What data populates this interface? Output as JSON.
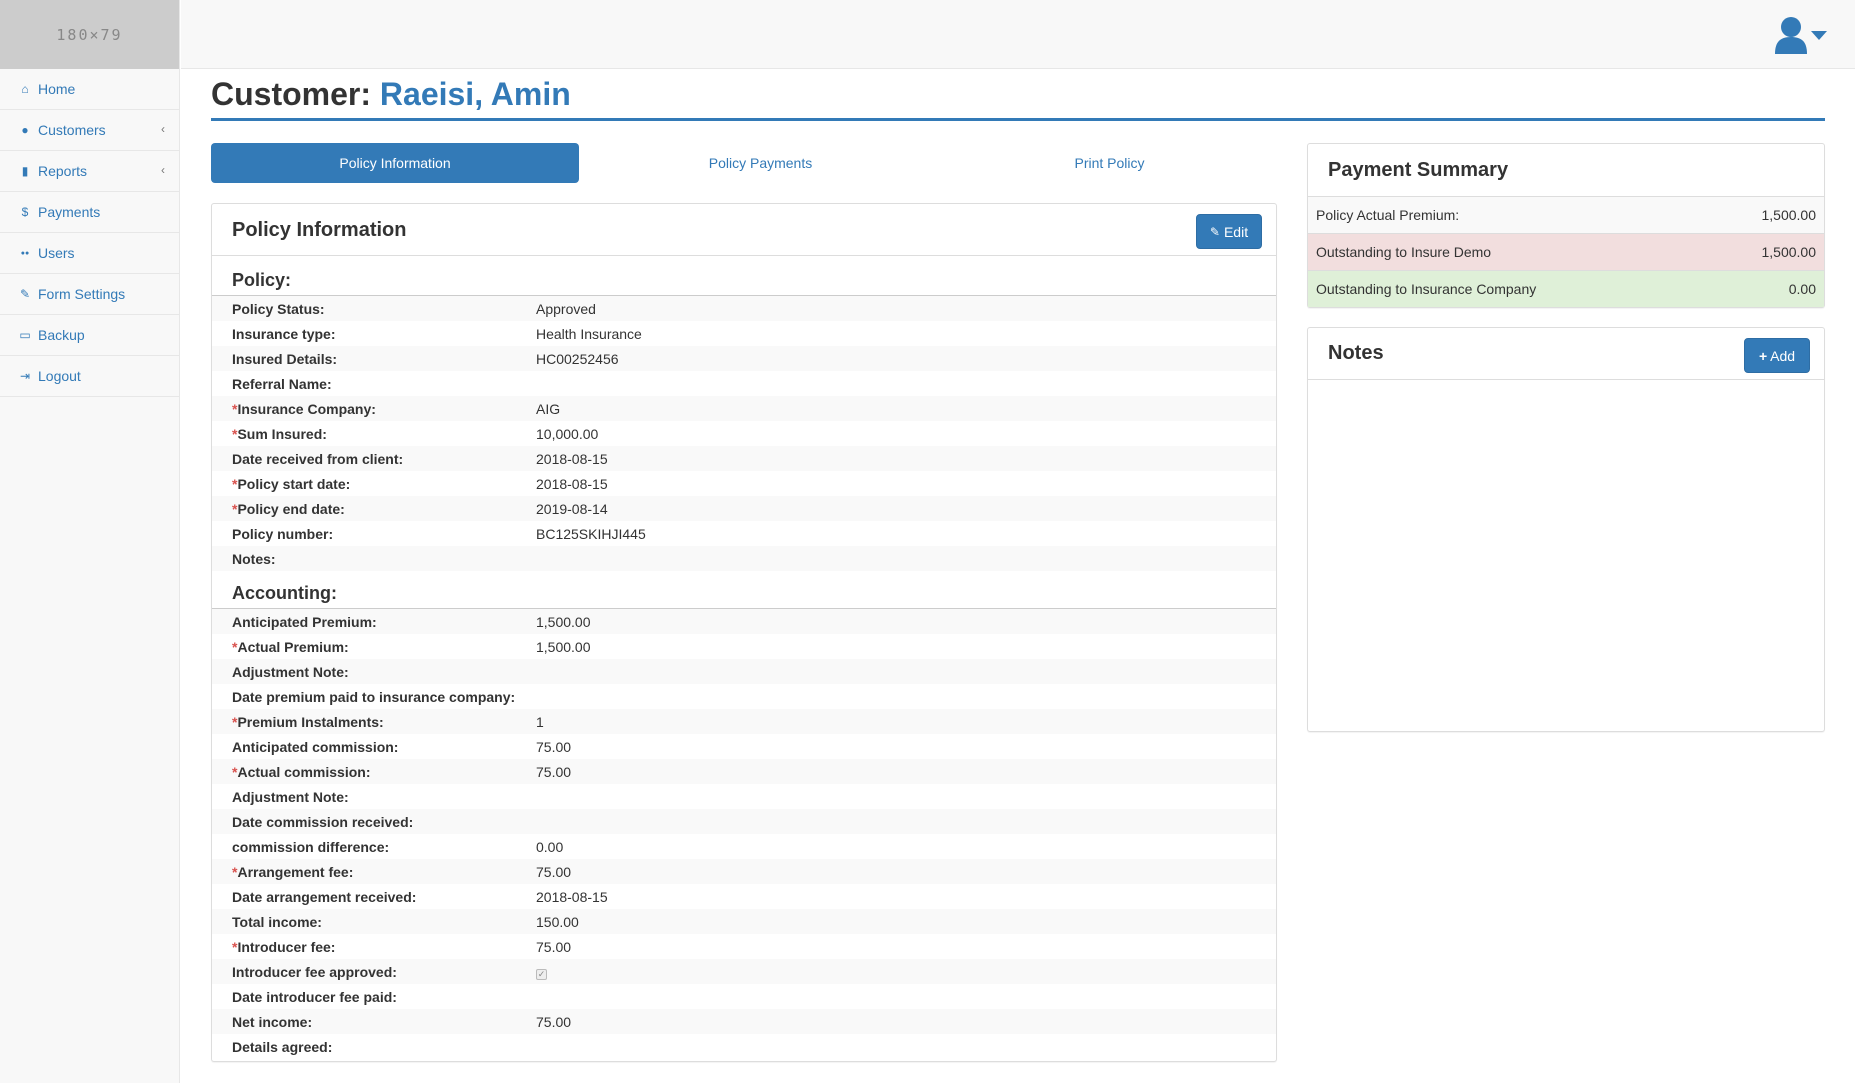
{
  "logo": {
    "text": "180×79"
  },
  "sidebar": {
    "items": [
      {
        "label": "Home",
        "icon": "home-icon"
      },
      {
        "label": "Customers",
        "icon": "user-icon",
        "chevron": "‹"
      },
      {
        "label": "Reports",
        "icon": "bar-chart-icon",
        "chevron": "‹"
      },
      {
        "label": "Payments",
        "icon": "dollar-icon"
      },
      {
        "label": "Users",
        "icon": "users-icon"
      },
      {
        "label": "Form Settings",
        "icon": "wrench-icon"
      },
      {
        "label": "Backup",
        "icon": "hdd-icon"
      },
      {
        "label": "Logout",
        "icon": "sign-out-icon"
      }
    ]
  },
  "header": {
    "title_prefix": "Customer:",
    "customer_name": "Raeisi, Amin"
  },
  "tabs": [
    {
      "label": "Policy Information",
      "active": true
    },
    {
      "label": "Policy Payments",
      "active": false
    },
    {
      "label": "Print Policy",
      "active": false
    }
  ],
  "policy_panel": {
    "title": "Policy Information",
    "edit_label": "Edit",
    "policy_section": "Policy:",
    "policy_rows": [
      {
        "label": "Policy Status:",
        "value": "Approved",
        "required": false
      },
      {
        "label": "Insurance type:",
        "value": "Health Insurance",
        "required": false
      },
      {
        "label": "Insured Details:",
        "value": "HC00252456",
        "required": false
      },
      {
        "label": "Referral Name:",
        "value": "",
        "required": false
      },
      {
        "label": "Insurance Company:",
        "value": "AIG",
        "required": true
      },
      {
        "label": "Sum Insured:",
        "value": "10,000.00",
        "required": true
      },
      {
        "label": "Date received from client:",
        "value": "2018-08-15",
        "required": false
      },
      {
        "label": "Policy start date:",
        "value": "2018-08-15",
        "required": true
      },
      {
        "label": "Policy end date:",
        "value": "2019-08-14",
        "required": true
      },
      {
        "label": "Policy number:",
        "value": "BC125SKIHJI445",
        "required": false
      },
      {
        "label": "Notes:",
        "value": "",
        "required": false
      }
    ],
    "accounting_section": "Accounting:",
    "accounting_rows": [
      {
        "label": "Anticipated Premium:",
        "value": "1,500.00",
        "required": false
      },
      {
        "label": "Actual Premium:",
        "value": "1,500.00",
        "required": true
      },
      {
        "label": "Adjustment Note:",
        "value": "",
        "required": false
      },
      {
        "label": "Date premium paid to insurance company:",
        "value": "",
        "required": false
      },
      {
        "label": "Premium Instalments:",
        "value": "1",
        "required": true
      },
      {
        "label": "Anticipated commission:",
        "value": "75.00",
        "required": false
      },
      {
        "label": "Actual commission:",
        "value": "75.00",
        "required": true
      },
      {
        "label": "Adjustment Note:",
        "value": "",
        "required": false
      },
      {
        "label": "Date commission received:",
        "value": "",
        "required": false
      },
      {
        "label": "commission difference:",
        "value": "0.00",
        "required": false
      },
      {
        "label": "Arrangement fee:",
        "value": "75.00",
        "required": true
      },
      {
        "label": "Date arrangement received:",
        "value": "2018-08-15",
        "required": false
      },
      {
        "label": "Total income:",
        "value": "150.00",
        "required": false
      },
      {
        "label": "Introducer fee:",
        "value": "75.00",
        "required": true
      },
      {
        "label": "Introducer fee approved:",
        "value": "",
        "required": false,
        "checkbox": true,
        "checked": true
      },
      {
        "label": "Date introducer fee paid:",
        "value": "",
        "required": false
      },
      {
        "label": "Net income:",
        "value": "75.00",
        "required": false
      },
      {
        "label": "Details agreed:",
        "value": "",
        "required": false
      }
    ]
  },
  "payment_summary": {
    "title": "Payment Summary",
    "rows": [
      {
        "label": "Policy Actual Premium:",
        "value": "1,500.00",
        "bg": "#f9f9f9"
      },
      {
        "label": "Outstanding to Insure Demo",
        "value": "1,500.00",
        "bg": "#f2dede"
      },
      {
        "label": "Outstanding to Insurance Company",
        "value": "0.00",
        "bg": "#dff0d8"
      }
    ]
  },
  "notes": {
    "title": "Notes",
    "add_label": "Add"
  },
  "colors": {
    "primary": "#337ab7",
    "danger_bg": "#f2dede",
    "success_bg": "#dff0d8",
    "required": "#d9534f"
  }
}
